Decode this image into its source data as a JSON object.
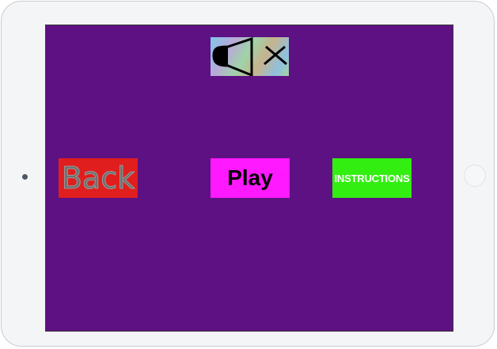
{
  "menu": {
    "back_label": "Back",
    "play_label": "Play",
    "instructions_label": "INSTRUCTIONS"
  },
  "sound_toggle": {
    "icon": "speaker-muted-icon"
  },
  "colors": {
    "background": "#5e1182",
    "back_button": "#e01e1e",
    "play_button": "#ff19ff",
    "instructions_button": "#33ee11"
  }
}
